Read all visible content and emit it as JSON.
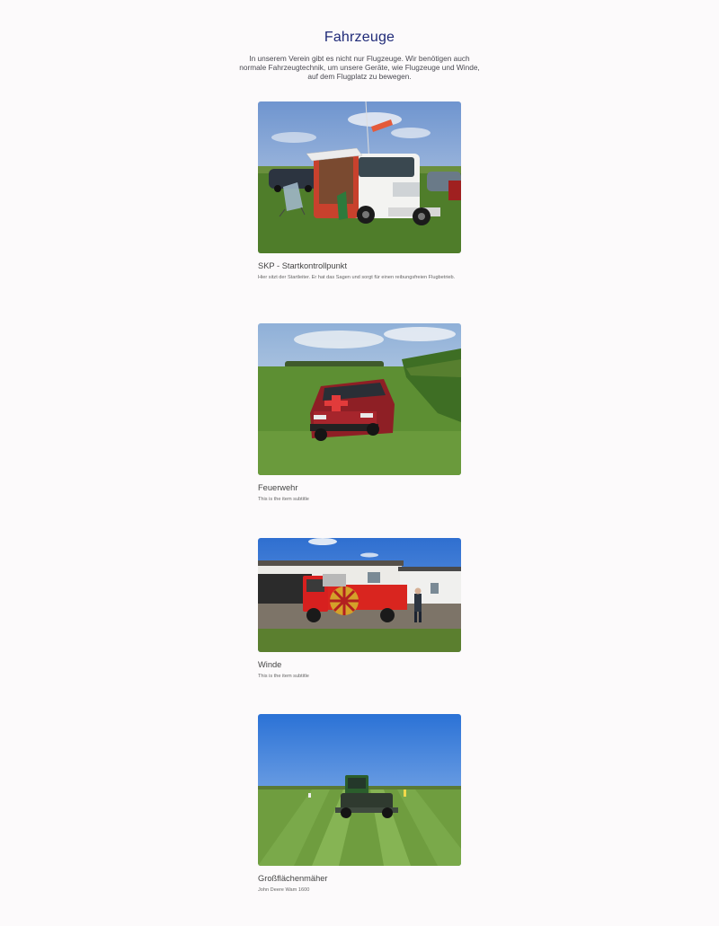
{
  "page": {
    "title": "Fahrzeuge",
    "intro": "In unserem Verein gibt es nicht nur Flugzeuge. Wir benötigen auch normale Fahrzeugtechnik, um unsere Geräte, wie Flugzeuge und Winde, auf dem Flugplatz zu bewegen."
  },
  "items": [
    {
      "title": "SKP - Startkontrollpunkt",
      "subtitle": "Hier sitzt der Startleiter. Er hat das Sagen und sorgt für einen reibungsfreien Flugbetrieb.",
      "image": "photo-vw-bus"
    },
    {
      "title": "Feuerwehr",
      "subtitle": "This is the item subtitle",
      "image": "photo-red-car"
    },
    {
      "title": "Winde",
      "subtitle": "This is the item subtitle",
      "image": "photo-winch-truck"
    },
    {
      "title": "Großflächenmäher",
      "subtitle": "John Deere Wam 1600",
      "image": "photo-mower"
    }
  ],
  "colors": {
    "title": "#1f2a78",
    "background": "#fcfafb"
  }
}
